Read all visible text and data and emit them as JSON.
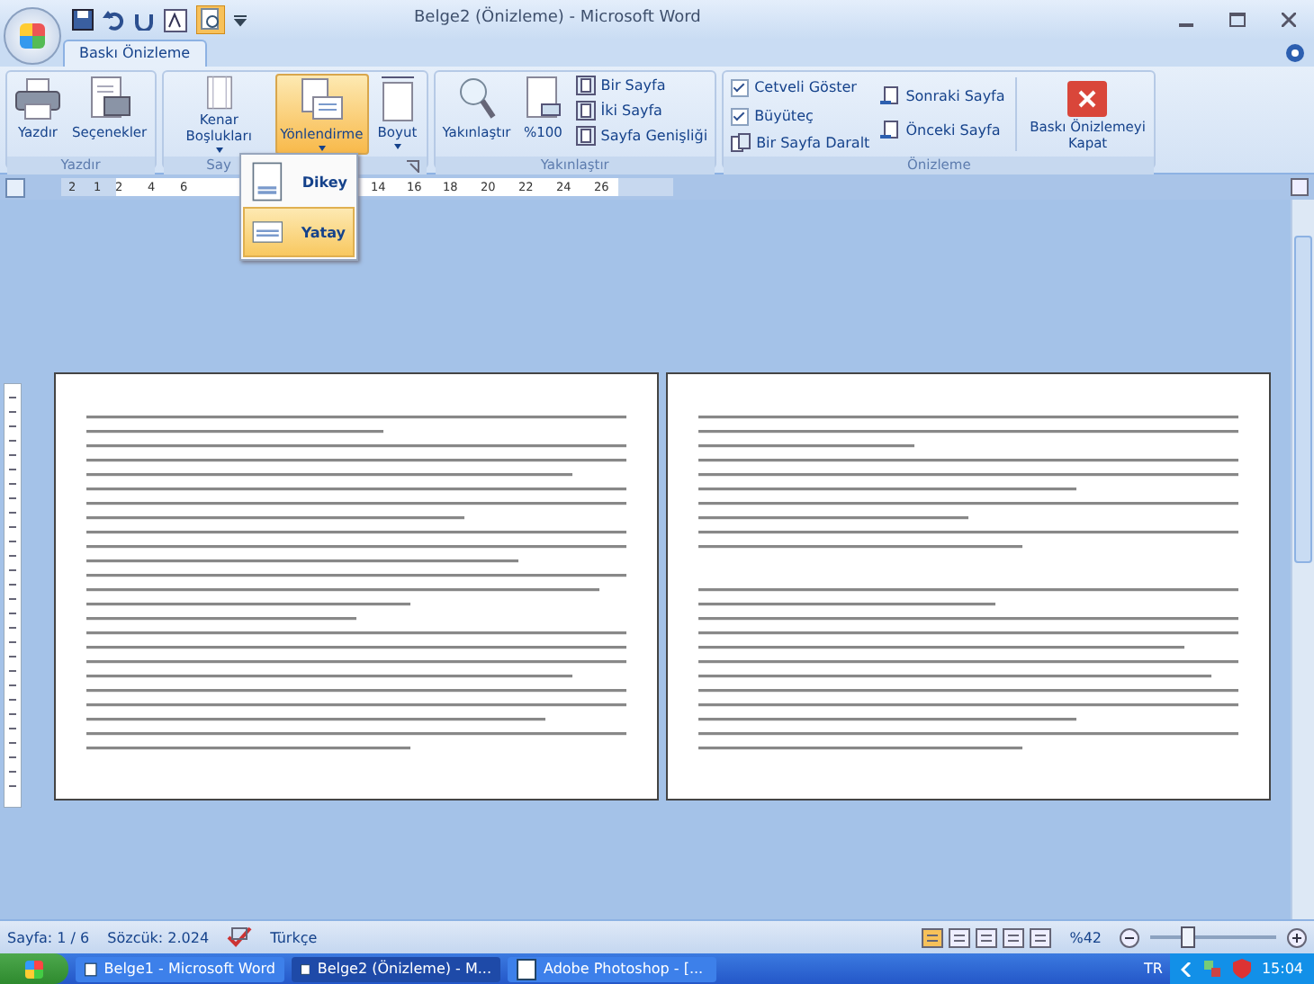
{
  "window": {
    "title": "Belge2 (Önizleme) - Microsoft Word"
  },
  "tabs": [
    {
      "label": "Baskı Önizleme",
      "selected": true
    }
  ],
  "ribbon": {
    "groups": [
      {
        "label": "Yazdır",
        "buttons": [
          {
            "label": "Yazdır",
            "kind": "printer"
          },
          {
            "label": "Seçenekler",
            "kind": "options"
          }
        ]
      },
      {
        "label": "Say",
        "buttons": [
          {
            "label": "Kenar Boşlukları",
            "kind": "margins",
            "active": false
          },
          {
            "label": "Yönlendirme",
            "kind": "orientation",
            "active": true
          },
          {
            "label": "Boyut",
            "kind": "size",
            "active": false
          }
        ]
      },
      {
        "label": "Yakınlaştır",
        "buttons": [
          {
            "label": "Yakınlaştır",
            "kind": "zoom"
          },
          {
            "label": "%100",
            "kind": "page100"
          }
        ],
        "small": [
          {
            "label": "Bir Sayfa"
          },
          {
            "label": "İki Sayfa"
          },
          {
            "label": "Sayfa Genişliği"
          }
        ]
      },
      {
        "label": "Önizleme",
        "checks": [
          {
            "label": "Cetveli Göster",
            "checked": true
          },
          {
            "label": "Büyüteç",
            "checked": true
          }
        ],
        "small": [
          {
            "label": "Bir Sayfa Daralt"
          },
          {
            "label": "Sonraki Sayfa"
          },
          {
            "label": "Önceki Sayfa"
          }
        ],
        "close": "Baskı Önizlemeyi Kapat"
      }
    ]
  },
  "orientation_menu": [
    {
      "label": "Dikey",
      "selected": false
    },
    {
      "label": "Yatay",
      "selected": true
    }
  ],
  "ruler": {
    "labels": [
      "2",
      "1",
      "2",
      "4",
      "6",
      "14",
      "16",
      "18",
      "20",
      "22",
      "24",
      "26"
    ]
  },
  "status_bar": {
    "page": "Sayfa: 1 / 6",
    "words": "Sözcük: 2.024",
    "language": "Türkçe",
    "zoom": "%42",
    "zoom_slider": {
      "level": 0.28
    }
  },
  "taskbar": {
    "items": [
      {
        "label": "Belge1 - Microsoft Word",
        "selected": false
      },
      {
        "label": "Belge2 (Önizleme) - M...",
        "selected": true
      },
      {
        "label": "Adobe Photoshop - [...",
        "selected": false
      }
    ],
    "language": "TR",
    "time": "15:04"
  }
}
